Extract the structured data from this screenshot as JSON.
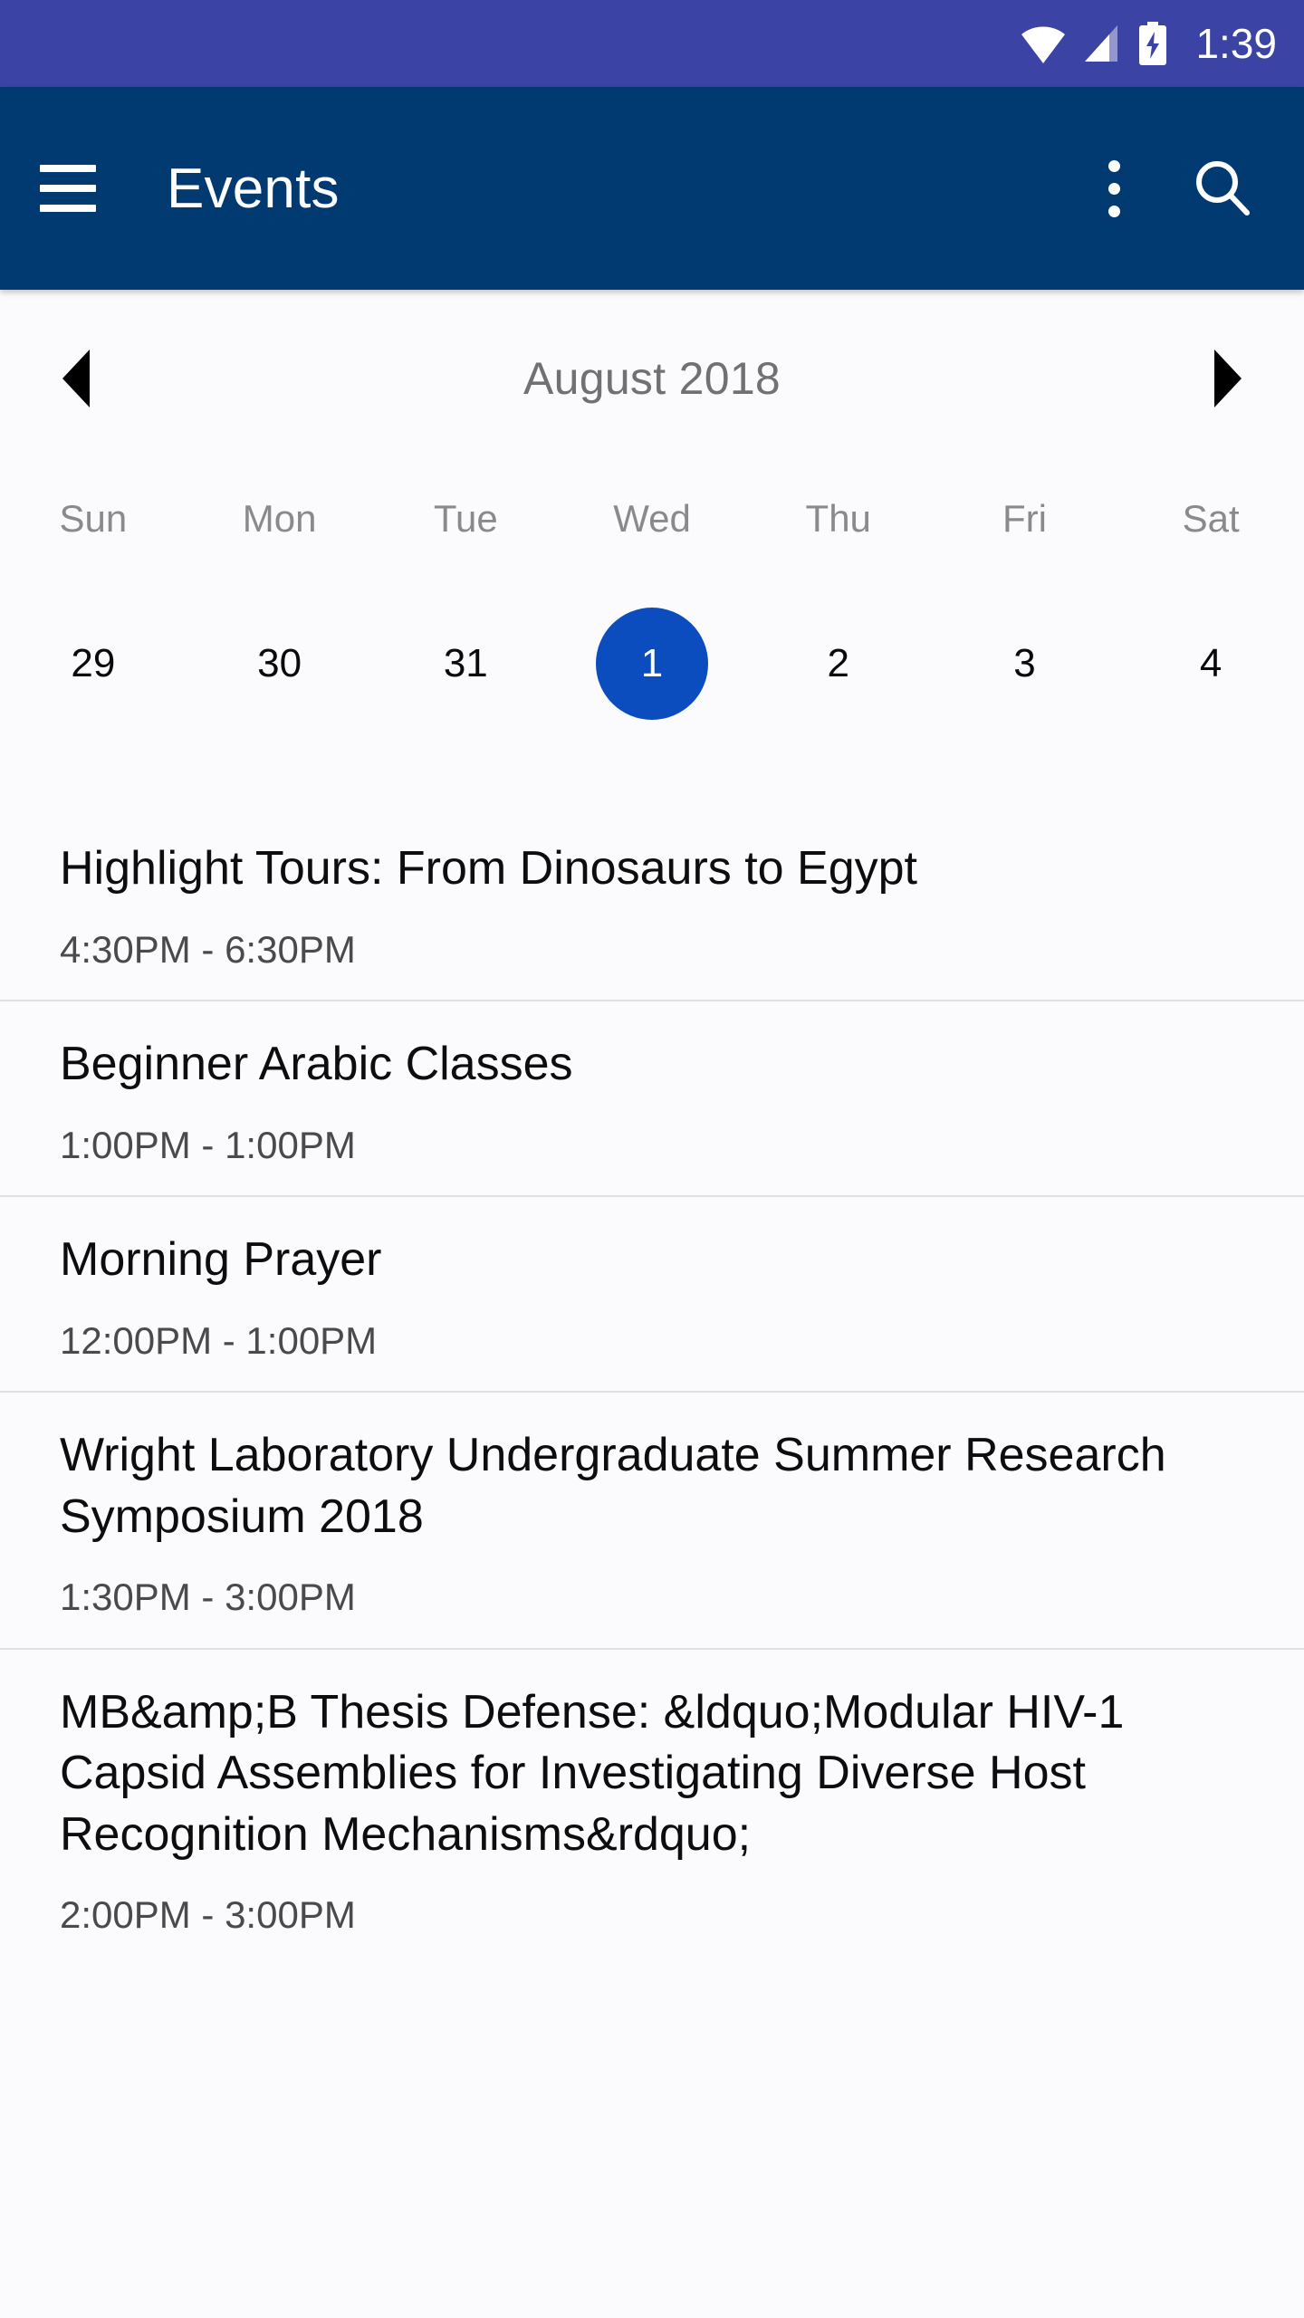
{
  "status_bar": {
    "background_color": "#3B43A4",
    "time": "1:39",
    "icons": [
      "wifi-icon",
      "signal-icon",
      "battery-charging-icon"
    ]
  },
  "app_bar": {
    "background_color": "#003A70",
    "title": "Events",
    "menu_icon": "hamburger-menu-icon",
    "overflow_icon": "overflow-menu-icon",
    "search_icon": "search-icon"
  },
  "calendar": {
    "prev_arrow": "chevron-left-icon",
    "next_arrow": "chevron-right-icon",
    "month_label": "August 2018",
    "weekdays": [
      "Sun",
      "Mon",
      "Tue",
      "Wed",
      "Thu",
      "Fri",
      "Sat"
    ],
    "selected_color": "#0B4DBE",
    "dates": [
      {
        "label": "29",
        "selected": false
      },
      {
        "label": "30",
        "selected": false
      },
      {
        "label": "31",
        "selected": false
      },
      {
        "label": "1",
        "selected": true
      },
      {
        "label": "2",
        "selected": false
      },
      {
        "label": "3",
        "selected": false
      },
      {
        "label": "4",
        "selected": false
      }
    ]
  },
  "events": [
    {
      "title": "Highlight Tours: From Dinosaurs to Egypt",
      "time": "4:30PM - 6:30PM"
    },
    {
      "title": "Beginner Arabic Classes",
      "time": "1:00PM - 1:00PM"
    },
    {
      "title": "Morning Prayer",
      "time": "12:00PM - 1:00PM"
    },
    {
      "title": "Wright Laboratory Undergraduate Summer Research Symposium 2018",
      "time": "1:30PM - 3:00PM"
    },
    {
      "title": "MB&amp;B Thesis Defense: &ldquo;Modular HIV-1 Capsid Assemblies for Investigating Diverse Host Recognition Mechanisms&rdquo;",
      "time": "2:00PM - 3:00PM"
    }
  ]
}
